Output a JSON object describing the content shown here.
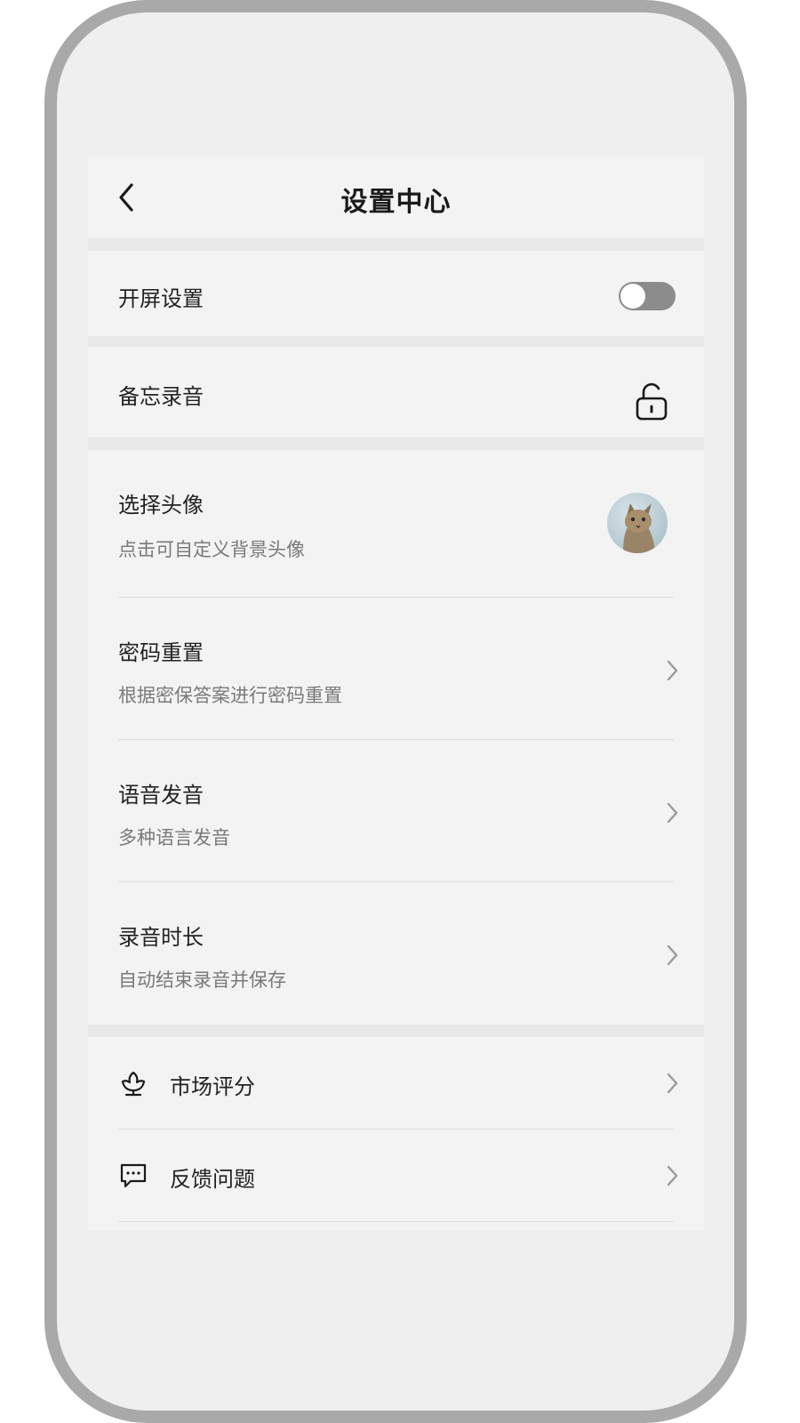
{
  "header": {
    "title": "设置中心"
  },
  "items": {
    "splash": {
      "label": "开屏设置"
    },
    "memo": {
      "label": "备忘录音"
    },
    "avatar": {
      "label": "选择头像",
      "sub": "点击可自定义背景头像"
    },
    "password": {
      "label": "密码重置",
      "sub": "根据密保答案进行密码重置"
    },
    "voice": {
      "label": "语音发音",
      "sub": "多种语言发音"
    },
    "duration": {
      "label": "录音时长",
      "sub": "自动结束录音并保存"
    },
    "rating": {
      "label": "市场评分"
    },
    "feedback": {
      "label": "反馈问题"
    }
  },
  "icons": {
    "back": "chevron-left-icon",
    "lock": "unlock-icon",
    "rating": "flower-icon",
    "feedback": "chat-bubble-icon",
    "chevron": "chevron-right-icon"
  },
  "colors": {
    "toggle_track": "#8c8c8c",
    "background": "#f3f3f3",
    "separator": "#e8e8e8"
  }
}
